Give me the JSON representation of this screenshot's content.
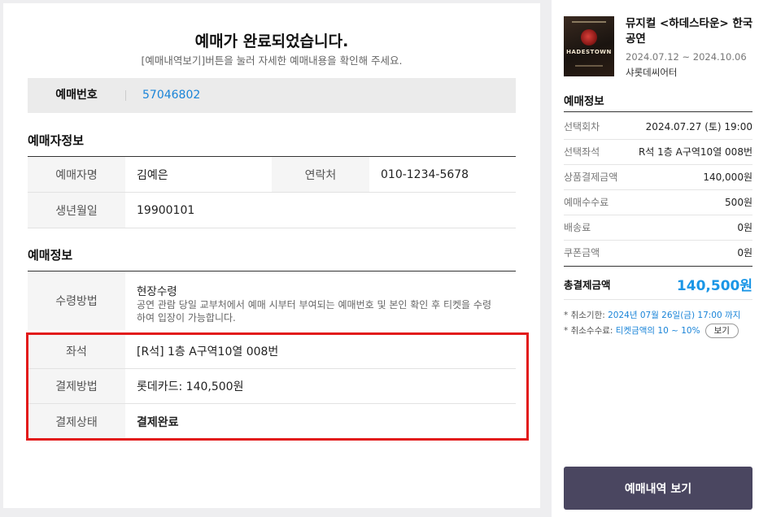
{
  "main": {
    "title": "예매가 완료되었습니다.",
    "subtitle": "[예매내역보기]버튼을 눌러 자세한 예매내용을 확인해 주세요.",
    "reservation_number": {
      "label": "예매번호",
      "value": "57046802"
    }
  },
  "booker": {
    "section_title": "예매자정보",
    "name_label": "예매자명",
    "name_value": "김예은",
    "phone_label": "연락처",
    "phone_value": "010-1234-5678",
    "birth_label": "생년월일",
    "birth_value": "19900101"
  },
  "booking": {
    "section_title": "예매정보",
    "pickup_label": "수령방법",
    "pickup_value": "현장수령",
    "pickup_desc": "공연 관람 당일 교부처에서 예매 시부터 부여되는 예매번호 및 본인 확인 후 티켓을 수령 하여 입장이 가능합니다.",
    "seat_label": "좌석",
    "seat_value": "[R석] 1층 A구역10열 008번",
    "payment_label": "결제방법",
    "payment_value": "롯데카드: 140,500원",
    "status_label": "결제상태",
    "status_value": "결제완료"
  },
  "sidebar": {
    "show_title": "뮤지컬 <하데스타운> 한국 공연",
    "show_dates": "2024.07.12 ~ 2024.10.06",
    "venue": "샤롯데씨어터",
    "poster_text": "HADESTOWN",
    "section_title": "예매정보",
    "rows": [
      {
        "label": "선택회차",
        "value": "2024.07.27 (토) 19:00"
      },
      {
        "label": "선택좌석",
        "value": "R석 1층 A구역10열 008번"
      },
      {
        "label": "상품결제금액",
        "value": "140,000원"
      },
      {
        "label": "예매수수료",
        "value": "500원"
      },
      {
        "label": "배송료",
        "value": "0원"
      },
      {
        "label": "쿠폰금액",
        "value": "0원"
      }
    ],
    "total_label": "총결제금액",
    "total_value": "140,500원",
    "cancel_deadline_prefix": "* 취소기한: ",
    "cancel_deadline_value": "2024년 07월 26일(금) 17:00 까지",
    "cancel_fee_prefix": "* 취소수수료: ",
    "cancel_fee_value": "티켓금액의 10 ~ 10%",
    "cancel_fee_button": "보기",
    "cta_label": "예매내역 보기"
  },
  "colors": {
    "accent": "#1a84d8",
    "total": "#1a96e6",
    "highlight": "#e21b1b",
    "cta": "#4a4660"
  }
}
